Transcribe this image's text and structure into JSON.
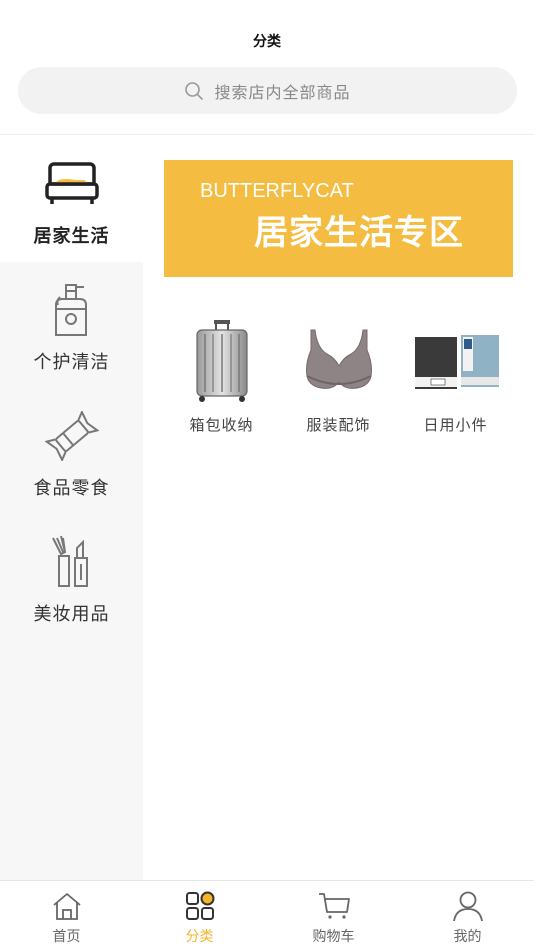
{
  "header": {
    "title": "分类"
  },
  "search": {
    "placeholder": "搜索店内全部商品",
    "icon": "search-icon"
  },
  "sidebar": {
    "items": [
      {
        "label": "居家生活",
        "icon": "bed-icon",
        "active": true
      },
      {
        "label": "个护清洁",
        "icon": "lotion-bottle-icon",
        "active": false
      },
      {
        "label": "食品零食",
        "icon": "candy-icon",
        "active": false
      },
      {
        "label": "美妆用品",
        "icon": "makeup-icon",
        "active": false
      }
    ]
  },
  "banner": {
    "brand": "BUTTERFLYCAT",
    "title": "居家生活专区"
  },
  "subcategories": [
    {
      "label": "箱包收纳",
      "image": "suitcase"
    },
    {
      "label": "服装配饰",
      "image": "bra"
    },
    {
      "label": "日用小件",
      "image": "notebooks"
    }
  ],
  "tabbar": {
    "tabs": [
      {
        "label": "首页",
        "icon": "home-icon",
        "active": false
      },
      {
        "label": "分类",
        "icon": "category-icon",
        "active": true
      },
      {
        "label": "购物车",
        "icon": "cart-icon",
        "active": false
      },
      {
        "label": "我的",
        "icon": "user-icon",
        "active": false
      }
    ]
  },
  "colors": {
    "accent": "#f4bd42",
    "tab_active": "#f4b52b",
    "sidebar_bg": "#f7f7f7"
  }
}
